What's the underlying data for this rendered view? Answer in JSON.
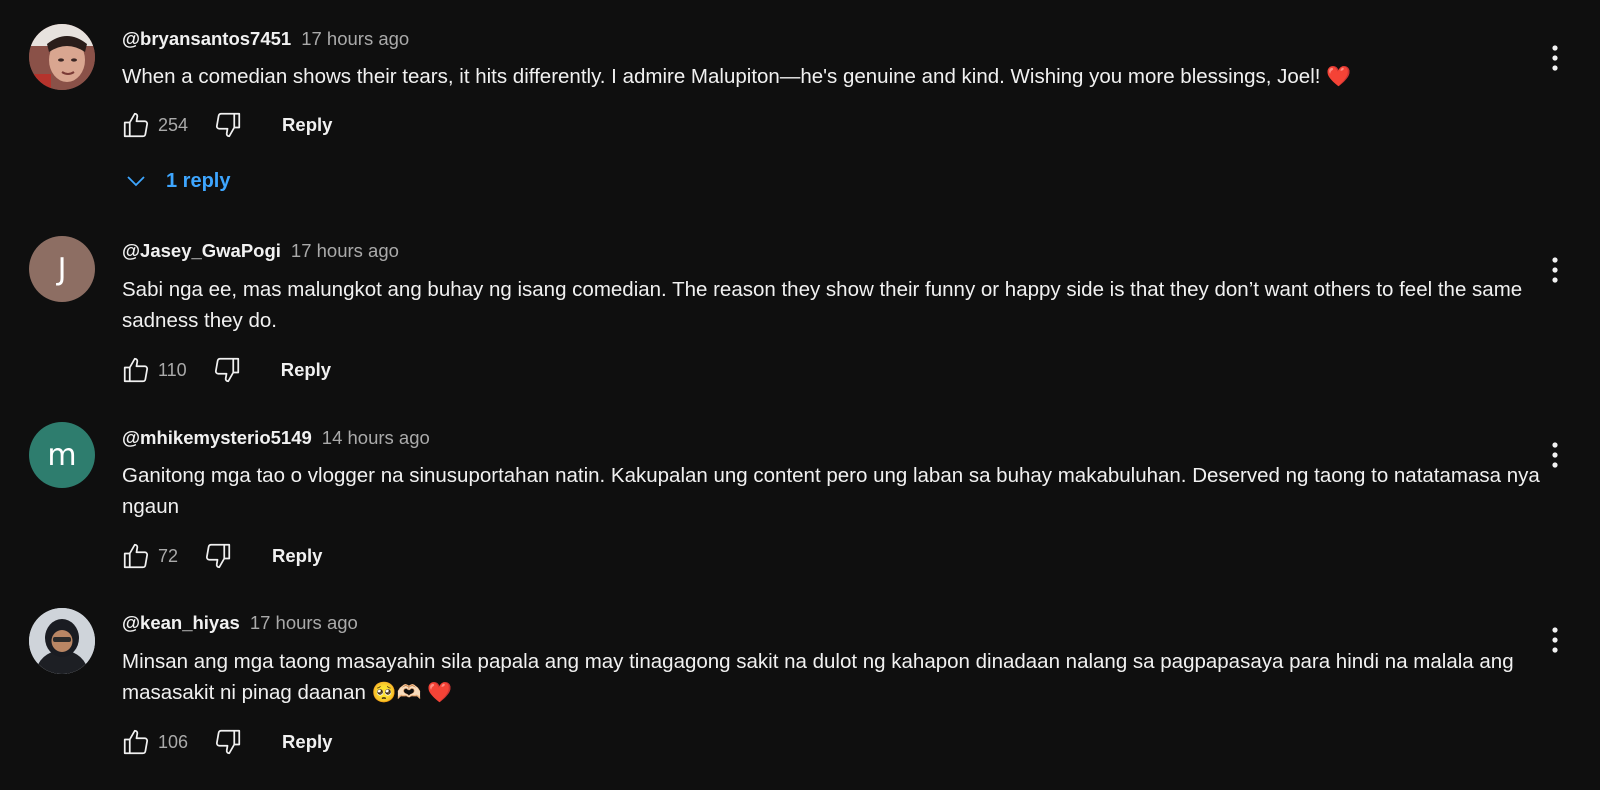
{
  "comments": [
    {
      "author": "@bryansantos7451",
      "time": "17 hours ago",
      "text": "When a comedian shows their tears, it hits differently. I admire Malupiton—he's genuine and kind. Wishing you more blessings, Joel!",
      "emoji": "❤️",
      "likes": "254",
      "reply_label": "Reply",
      "replies_label": "1 reply",
      "avatar": "photo"
    },
    {
      "author": "@Jasey_GwaPogi",
      "time": "17 hours ago",
      "text": "Sabi nga ee, mas malungkot ang buhay ng isang comedian. The reason they show their funny or happy side is that they don’t want others to feel the same sadness they do.",
      "likes": "110",
      "reply_label": "Reply",
      "avatar_letter": "J",
      "avatar_color": "#8d6e63"
    },
    {
      "author": "@mhikemysterio5149",
      "time": "14 hours ago",
      "text": "Ganitong mga tao o vlogger na sinusuportahan natin. Kakupalan ung content pero ung laban sa buhay makabuluhan. Deserved ng taong to natatamasa nya ngaun",
      "likes": "72",
      "reply_label": "Reply",
      "avatar_letter": "m",
      "avatar_color": "#2e7d6e"
    },
    {
      "author": "@kean_hiyas",
      "time": "17 hours ago",
      "text": "Minsan ang mga taong masayahin sila papala ang may tinagagong sakit na dulot ng kahapon dinadaan nalang sa pagpapasaya para hindi na malala ang masasakit ni pinag daanan",
      "emoji": "🥺🫶🏻 ❤️",
      "likes": "106",
      "reply_label": "Reply",
      "avatar": "photo"
    }
  ],
  "icons": {
    "like": "thumb-up-icon",
    "dislike": "thumb-down-icon",
    "more": "more-vert-icon",
    "expand": "chevron-down-icon"
  },
  "colors": {
    "background": "#0f0f0f",
    "text": "#f1f1f1",
    "secondary": "#aaaaaa",
    "link": "#3ea6ff"
  }
}
